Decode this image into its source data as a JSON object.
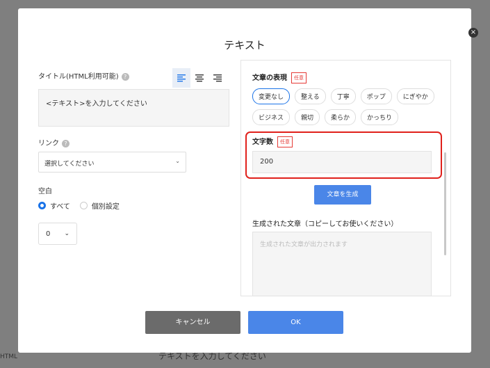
{
  "background": {
    "text": "テキストを入力してください",
    "left_text": "HTML"
  },
  "dialog": {
    "title": "テキスト",
    "close_icon": "×",
    "title_label": "タイトル(HTML利用可能)",
    "help": "?",
    "align_icons": [
      "align-left-icon",
      "align-center-icon",
      "align-right-icon"
    ],
    "text_placeholder": "<テキスト>を入力してください",
    "link_label": "リンク",
    "link_select": {
      "value": "選択してください",
      "chevron": "⌄"
    },
    "spacing_label": "空白",
    "spacing_options": [
      {
        "label": "すべて",
        "checked": true
      },
      {
        "label": "個別設定",
        "checked": false
      }
    ],
    "spacing_value": "0",
    "spacing_chevron": "⌄",
    "cancel": "キャンセル",
    "ok": "OK"
  },
  "panel": {
    "expression_label": "文章の表現",
    "optional_badge": "任意",
    "chips": [
      "変更なし",
      "整える",
      "丁寧",
      "ポップ",
      "にぎやか",
      "ビジネス",
      "親切",
      "柔らか",
      "かっちり"
    ],
    "selected_chip": "変更なし",
    "char_count_label": "文字数",
    "char_count_value": "200",
    "generate_button": "文章を生成",
    "output_label": "生成された文章（コピーしてお使いください）",
    "output_placeholder": "生成された文章が出力されます"
  },
  "colors": {
    "accent": "#4a86e8",
    "highlight": "#e0201b",
    "badge": "#e53935"
  }
}
